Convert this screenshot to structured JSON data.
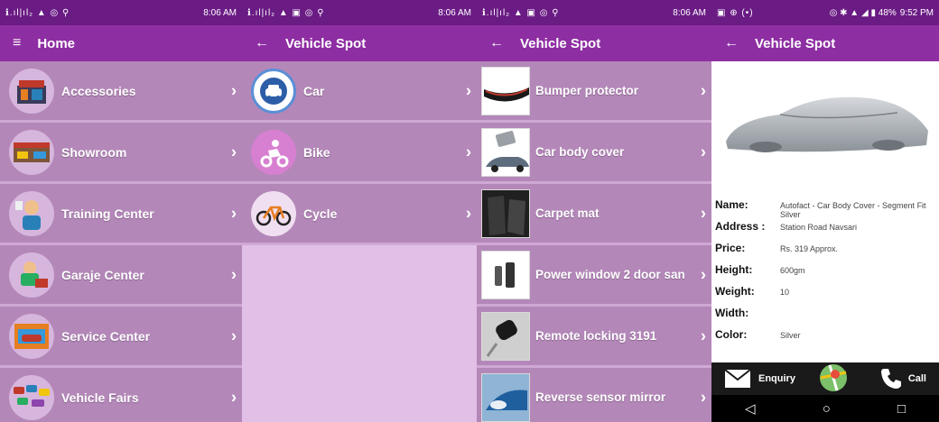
{
  "screens": [
    {
      "status": {
        "left": "ℹ.ıl|ıl₂ ▲ ◎ ⚲",
        "time": "8:06 AM"
      },
      "appbar": {
        "title": "Home",
        "icon": "menu-icon"
      },
      "items": [
        {
          "label": "Accessories",
          "icon": "accessories-icon"
        },
        {
          "label": "Showroom",
          "icon": "showroom-icon"
        },
        {
          "label": "Training Center",
          "icon": "training-icon"
        },
        {
          "label": "Garaje Center",
          "icon": "garage-icon"
        },
        {
          "label": "Service Center",
          "icon": "service-icon"
        },
        {
          "label": "Vehicle Fairs",
          "icon": "fairs-icon"
        }
      ]
    },
    {
      "status": {
        "left": "ℹ.ıl|ıl₂ ▲ ▣ ◎ ⚲",
        "time": "8:06 AM"
      },
      "appbar": {
        "title": "Vehicle Spot",
        "icon": "back-arrow-icon"
      },
      "items": [
        {
          "label": "Car",
          "icon": "car-icon"
        },
        {
          "label": "Bike",
          "icon": "bike-icon"
        },
        {
          "label": "Cycle",
          "icon": "cycle-icon"
        }
      ]
    },
    {
      "status": {
        "left": "ℹ.ıl|ıl₂ ▲ ▣ ◎ ⚲",
        "time": "8:06 AM"
      },
      "appbar": {
        "title": "Vehicle Spot",
        "icon": "back-arrow-icon"
      },
      "items": [
        {
          "label": "Bumper protector"
        },
        {
          "label": "Car body cover"
        },
        {
          "label": "Carpet mat"
        },
        {
          "label": "Power window 2 door san"
        },
        {
          "label": "Remote locking 3191"
        },
        {
          "label": "Reverse sensor mirror"
        }
      ]
    },
    {
      "status": {
        "left": "▣ ⊕ (•)",
        "right": "◎ ✱ ▲ ◢ ▮ 48%",
        "time": "9:52 PM"
      },
      "appbar": {
        "title": "Vehicle Spot",
        "icon": "back-arrow-icon"
      },
      "details": [
        {
          "label": "Name:",
          "value": "Autofact - Car Body Cover - Segment Fit Silver"
        },
        {
          "label": "Address :",
          "value": "Station Road Navsari"
        },
        {
          "label": "Price:",
          "value": "Rs. 319 Approx."
        },
        {
          "label": "Height:",
          "value": "600gm"
        },
        {
          "label": "Weight:",
          "value": "10"
        },
        {
          "label": "Width:",
          "value": ""
        },
        {
          "label": "Color:",
          "value": "Silver"
        }
      ],
      "actions": {
        "enquiry": "Enquiry",
        "call": "Call"
      }
    }
  ],
  "colors": {
    "statusbar": "#6a1b84",
    "appbar": "#8e2ea3",
    "list_bg": "#b487b9",
    "empty_bg": "#e1bfe6"
  }
}
